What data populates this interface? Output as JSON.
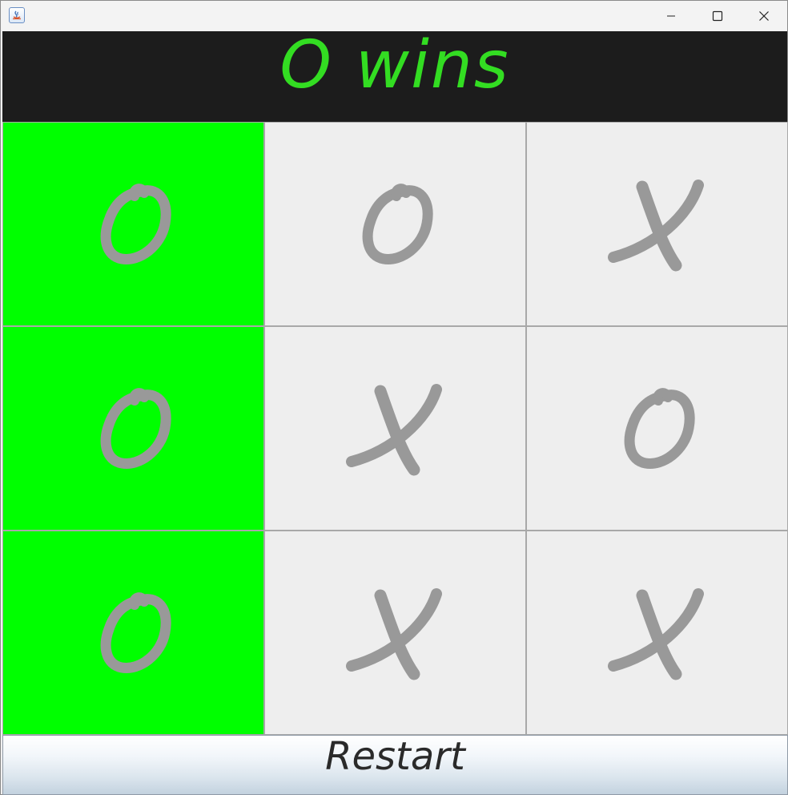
{
  "window": {
    "icon": "java-icon",
    "controls": [
      "minimize-icon",
      "maximize-icon",
      "close-icon"
    ]
  },
  "status": {
    "text": "O wins",
    "color": "#33dd22",
    "background": "#1c1c1c"
  },
  "board": {
    "cells": [
      {
        "mark": "O",
        "winning": true
      },
      {
        "mark": "O",
        "winning": false
      },
      {
        "mark": "X",
        "winning": false
      },
      {
        "mark": "O",
        "winning": true
      },
      {
        "mark": "X",
        "winning": false
      },
      {
        "mark": "O",
        "winning": false
      },
      {
        "mark": "O",
        "winning": true
      },
      {
        "mark": "X",
        "winning": false
      },
      {
        "mark": "X",
        "winning": false
      }
    ],
    "mark_color": "#999999",
    "cell_color": "#eeeeee",
    "win_color": "#00ff00"
  },
  "restart": {
    "label": "Restart"
  }
}
